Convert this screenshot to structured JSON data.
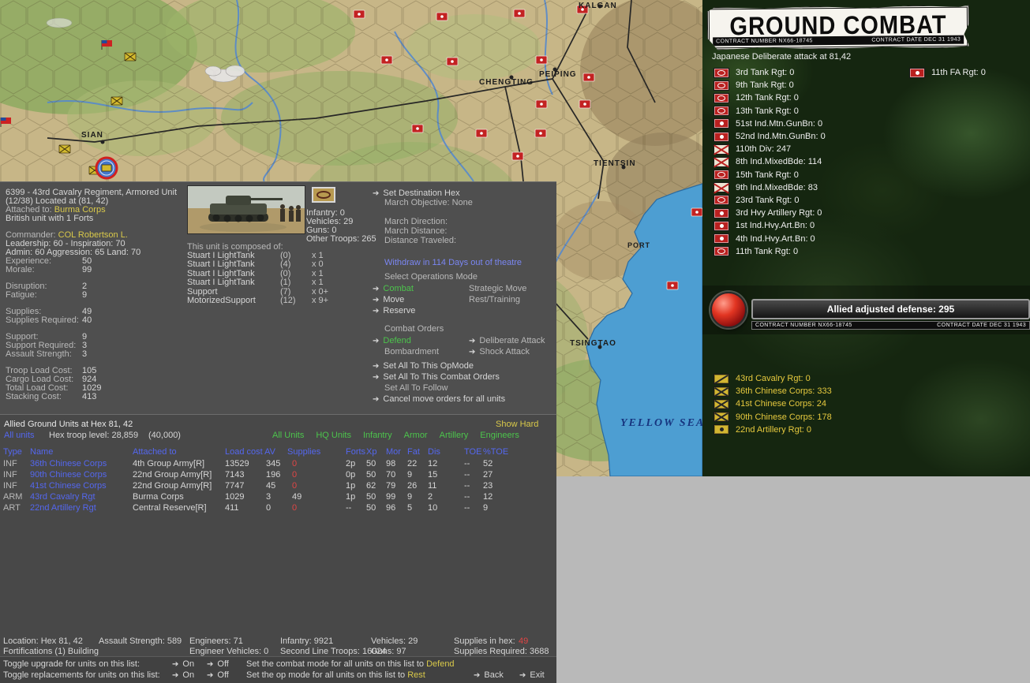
{
  "icons": {
    "arrow": "➔"
  },
  "map": {
    "cities": [
      {
        "name": "KALGAN"
      },
      {
        "name": "PEIPING"
      },
      {
        "name": "CHENGTING"
      },
      {
        "name": "SIAN"
      },
      {
        "name": "TIENTSIN"
      },
      {
        "name": "TSINGTAO"
      },
      {
        "name": "PORT"
      }
    ],
    "sea_label": "YELLOW SEA"
  },
  "unit": {
    "title": "6399 - 43rd Cavalry Regiment, Armored Unit",
    "subtitle": "(12/38) Located at (81, 42)",
    "attached_label": "Attached to:",
    "attached_value": "Burma Corps",
    "nation_line": "British unit with 1 Forts",
    "commander_label": "Commander:",
    "commander_value": "COL Robertson L.",
    "leadership_line": "Leadership: 60 - Inspiration: 70",
    "admin_line": "Admin: 60  Aggression: 65  Land: 70",
    "stats": [
      {
        "label": "Experience:",
        "value": "50"
      },
      {
        "label": "Morale:",
        "value": "99"
      },
      {
        "label": "Disruption:",
        "value": "2"
      },
      {
        "label": "Fatigue:",
        "value": "9"
      },
      {
        "label": "Supplies:",
        "value": "49"
      },
      {
        "label": "Supplies Required:",
        "value": "40"
      },
      {
        "label": "Support:",
        "value": "9"
      },
      {
        "label": "Support Required:",
        "value": "3"
      },
      {
        "label": "Assault Strength:",
        "value": "3"
      },
      {
        "label": "Troop Load Cost:",
        "value": "105"
      },
      {
        "label": "Cargo Load Cost:",
        "value": "924"
      },
      {
        "label": "Total Load Cost:",
        "value": "1029"
      },
      {
        "label": "Stacking Cost:",
        "value": "413"
      }
    ]
  },
  "composition": {
    "heading": "This unit is composed of:",
    "troops": [
      "Infantry: 0",
      "Vehicles: 29",
      "Guns: 0",
      "Other Troops: 265"
    ],
    "rows": [
      {
        "name": "Stuart I LightTank",
        "num": "(0)",
        "count": "x 1"
      },
      {
        "name": "Stuart I LightTank",
        "num": "(4)",
        "count": "x 0"
      },
      {
        "name": "Stuart I LightTank",
        "num": "(0)",
        "count": "x 1"
      },
      {
        "name": "Stuart I LightTank",
        "num": "(1)",
        "count": "x 1"
      },
      {
        "name": "Support",
        "num": "(7)",
        "count": "x 0+"
      },
      {
        "name": "MotorizedSupport",
        "num": "(12)",
        "count": "x 9+"
      }
    ]
  },
  "orders": {
    "set_destination": "Set Destination Hex",
    "march_objective": "March Objective: None",
    "march_direction": "March Direction:",
    "march_distance": "March Distance:",
    "distance_traveled": "Distance Traveled:",
    "withdraw": "Withdraw in 114 Days out of theatre",
    "select_ops_mode": "Select Operations Mode",
    "combat": "Combat",
    "strategic_move": "Strategic Move",
    "move": "Move",
    "rest_training": "Rest/Training",
    "reserve": "Reserve",
    "combat_orders": "Combat Orders",
    "defend": "Defend",
    "deliberate_attack": "Deliberate Attack",
    "bombardment": "Bombardment",
    "shock_attack": "Shock Attack",
    "set_all_opmode": "Set All To This OpMode",
    "set_all_combat": "Set All To This Combat Orders",
    "set_all_follow": "Set All To Follow",
    "cancel_move": "Cancel move orders for all units"
  },
  "units_table": {
    "title": "Allied Ground Units at Hex 81, 42",
    "show_hard": "Show Hard",
    "all_units_link": "All units",
    "troop_level": "Hex troop level: 28,859",
    "troop_cap": "(40,000)",
    "filters": [
      "All Units",
      "HQ Units",
      "Infantry",
      "Armor",
      "Artillery",
      "Engineers"
    ],
    "headers": {
      "type": "Type",
      "name": "Name",
      "attached": "Attached to",
      "load": "Load cost AV",
      "supplies": "Supplies",
      "forts": "Forts",
      "xp": "Xp",
      "mor": "Mor",
      "fat": "Fat",
      "dis": "Dis",
      "toe": "TOE",
      "ptoe": "%TOE"
    },
    "rows": [
      {
        "type": "INF",
        "name": "36th Chinese Corps",
        "attached": "4th Group Army[R]",
        "load": "13529",
        "av": "345",
        "supplies": "0",
        "forts": "2p",
        "xp": "50",
        "mor": "98",
        "fat": "22",
        "dis": "12",
        "toe": "--",
        "ptoe": "52"
      },
      {
        "type": "INF",
        "name": "90th Chinese Corps",
        "attached": "22nd Group Army[R]",
        "load": "7143",
        "av": "196",
        "supplies": "0",
        "forts": "0p",
        "xp": "50",
        "mor": "70",
        "fat": "9",
        "dis": "15",
        "toe": "--",
        "ptoe": "27"
      },
      {
        "type": "INF",
        "name": "41st Chinese Corps",
        "attached": "22nd Group Army[R]",
        "load": "7747",
        "av": "45",
        "supplies": "0",
        "forts": "1p",
        "xp": "62",
        "mor": "79",
        "fat": "26",
        "dis": "11",
        "toe": "--",
        "ptoe": "23"
      },
      {
        "type": "ARM",
        "name": "43rd Cavalry Rgt",
        "attached": "Burma Corps",
        "load": "1029",
        "av": "3",
        "supplies": "49",
        "forts": "1p",
        "xp": "50",
        "mor": "99",
        "fat": "9",
        "dis": "2",
        "toe": "--",
        "ptoe": "12"
      },
      {
        "type": "ART",
        "name": "22nd Artillery Rgt",
        "attached": "Central Reserve[R]",
        "load": "411",
        "av": "0",
        "supplies": "0",
        "forts": "--",
        "xp": "50",
        "mor": "96",
        "fat": "5",
        "dis": "10",
        "toe": "--",
        "ptoe": "9"
      }
    ],
    "summary": {
      "location": "Location: Hex 81, 42",
      "assault": "Assault Strength: 589",
      "engineers": "Engineers: 71",
      "infantry": "Infantry: 9921",
      "vehicles": "Vehicles: 29",
      "supplies_label": "Supplies in hex:",
      "supplies_value": "49",
      "fortifications": "Fortifications (1) Building",
      "eng_vehicles": "Engineer Vehicles: 0",
      "second_line": "Second Line Troops: 16024",
      "guns": "Guns: 97",
      "supplies_req": "Supplies Required: 3688"
    },
    "toggles": {
      "upgrade_label": "Toggle upgrade for units on this list:",
      "replace_label": "Toggle replacements for units on this list:",
      "on": "On",
      "off": "Off",
      "combat_mode_label": "Set the combat mode for all units on this list to",
      "combat_mode_value": "Defend",
      "op_mode_label": "Set the op mode for all units on this list to",
      "op_mode_value": "Rest",
      "back": "Back",
      "exit": "Exit"
    }
  },
  "combat": {
    "title": "GROUND COMBAT",
    "contract_number": "CONTRACT NUMBER   NX66-18745",
    "contract_date": "CONTRACT DATE   DEC 31 1943",
    "subtitle": "Japanese Deliberate attack at 81,42",
    "attackers": [
      {
        "label": "3rd Tank Rgt: 0",
        "type": "armor"
      },
      {
        "label": "9th Tank Rgt: 0",
        "type": "armor"
      },
      {
        "label": "12th Tank Rgt: 0",
        "type": "armor"
      },
      {
        "label": "13th Tank Rgt: 0",
        "type": "armor"
      },
      {
        "label": "51st Ind.Mtn.GunBn: 0",
        "type": "artillery"
      },
      {
        "label": "52nd Ind.Mtn.GunBn: 0",
        "type": "artillery"
      },
      {
        "label": "110th Div: 247",
        "type": "infantry"
      },
      {
        "label": "8th Ind.MixedBde: 114",
        "type": "infantry"
      },
      {
        "label": "15th Tank Rgt: 0",
        "type": "armor"
      },
      {
        "label": "9th Ind.MixedBde: 83",
        "type": "infantry"
      },
      {
        "label": "23rd Tank Rgt: 0",
        "type": "armor"
      },
      {
        "label": "3rd Hvy Artillery Rgt: 0",
        "type": "artillery"
      },
      {
        "label": "1st Ind.Hvy.Art.Bn: 0",
        "type": "artillery"
      },
      {
        "label": "4th Ind.Hvy.Art.Bn: 0",
        "type": "artillery"
      },
      {
        "label": "11th Tank Rgt: 0",
        "type": "armor"
      }
    ],
    "attacker_right": {
      "label": "11th FA Rgt: 0",
      "type": "artillery"
    },
    "defense_banner": "Allied adjusted defense: 295",
    "defenders": [
      {
        "label": "43rd Cavalry Rgt: 0",
        "type": "cavalry"
      },
      {
        "label": "36th Chinese Corps: 333",
        "type": "infantry"
      },
      {
        "label": "41st Chinese Corps: 24",
        "type": "infantry"
      },
      {
        "label": "90th Chinese Corps: 178",
        "type": "infantry"
      },
      {
        "label": "22nd Artillery Rgt: 0",
        "type": "artillery"
      }
    ]
  }
}
